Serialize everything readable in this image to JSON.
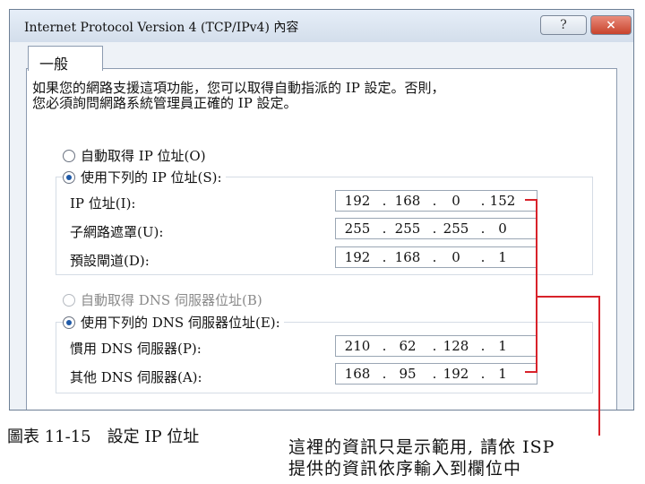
{
  "window": {
    "title": "Internet Protocol Version 4 (TCP/IPv4) 內容",
    "help_icon": "?",
    "close_icon": "×"
  },
  "tabs": [
    {
      "label": "一般"
    }
  ],
  "description": {
    "line1": "如果您的網路支援這項功能，您可以取得自動指派的 IP 設定。否則，",
    "line2": "您必須詢問網路系統管理員正確的 IP 設定。"
  },
  "ip_section": {
    "auto_label": "自動取得 IP 位址(O)",
    "auto_selected": false,
    "manual_label": "使用下列的 IP 位址(S):",
    "manual_selected": true,
    "fields": [
      {
        "label": "IP 位址(I):",
        "octets": [
          "192",
          "168",
          "0",
          "152"
        ]
      },
      {
        "label": "子網路遮罩(U):",
        "octets": [
          "255",
          "255",
          "255",
          "0"
        ]
      },
      {
        "label": "預設閘道(D):",
        "octets": [
          "192",
          "168",
          "0",
          "1"
        ]
      }
    ]
  },
  "dns_section": {
    "auto_label": "自動取得 DNS 伺服器位址(B)",
    "auto_selected": false,
    "auto_disabled": true,
    "manual_label": "使用下列的 DNS 伺服器位址(E):",
    "manual_selected": true,
    "fields": [
      {
        "label": "慣用 DNS 伺服器(P):",
        "octets": [
          "210",
          "62",
          "128",
          "1"
        ]
      },
      {
        "label": "其他 DNS 伺服器(A):",
        "octets": [
          "168",
          "95",
          "192",
          "1"
        ]
      }
    ]
  },
  "caption": "圖表 11-15　設定 IP 位址",
  "note": {
    "line1": "這裡的資訊只是示範用, 請依 ISP",
    "line2": "提供的資訊依序輸入到欄位中"
  },
  "colors": {
    "annotation": "#d8222a",
    "radio_selected": "#1f5aa8"
  }
}
